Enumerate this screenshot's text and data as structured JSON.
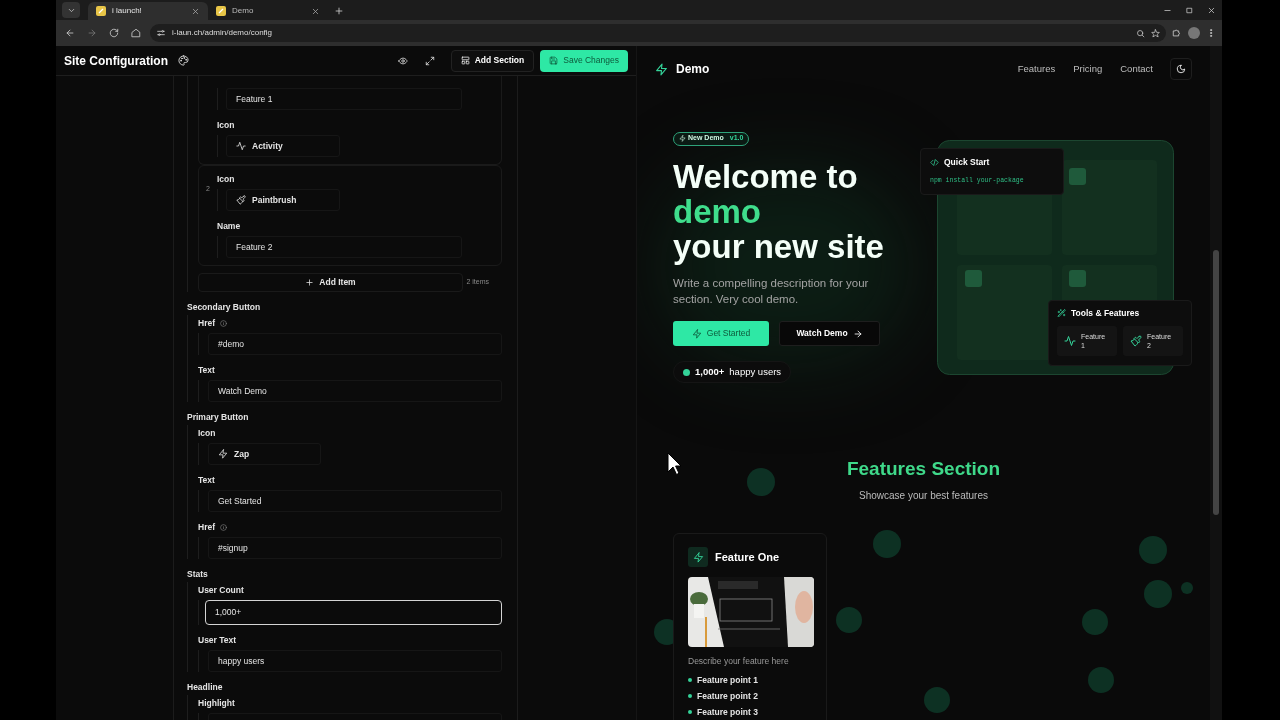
{
  "browser": {
    "tabs": [
      {
        "title": "i launch!",
        "selected": true
      },
      {
        "title": "Demo",
        "selected": false
      }
    ],
    "url": "i-laun.ch/admin/demo/config"
  },
  "header": {
    "title": "Site Configuration",
    "add_section": "Add Section",
    "save": "Save Changes"
  },
  "editor": {
    "items": [
      {
        "fields": [
          {
            "kind": "text",
            "value": "Feature 1"
          },
          {
            "label": "Icon",
            "kind": "icon",
            "value": "Activity"
          }
        ]
      },
      {
        "index": "2",
        "fields": [
          {
            "label": "Icon",
            "kind": "icon",
            "value": "Paintbrush"
          },
          {
            "label": "Name",
            "kind": "text",
            "value": "Feature 2"
          }
        ]
      }
    ],
    "add_item": "Add Item",
    "count": "2 items",
    "groups": [
      {
        "title": "Secondary Button",
        "fields": [
          {
            "label": "Href",
            "info": true,
            "focused": false,
            "kind": "text",
            "value": "#demo"
          },
          {
            "label": "Text",
            "info": false,
            "focused": false,
            "kind": "text",
            "value": "Watch Demo"
          }
        ]
      },
      {
        "title": "Primary Button",
        "fields": [
          {
            "label": "Icon",
            "info": false,
            "focused": false,
            "kind": "icon",
            "value": "Zap"
          },
          {
            "label": "Text",
            "info": false,
            "focused": false,
            "kind": "text",
            "value": "Get Started"
          },
          {
            "label": "Href",
            "info": true,
            "focused": false,
            "kind": "text",
            "value": "#signup"
          }
        ]
      },
      {
        "title": "Stats",
        "fields": [
          {
            "label": "User Count",
            "info": false,
            "focused": true,
            "kind": "text",
            "value": "1,000+"
          },
          {
            "label": "User Text",
            "info": false,
            "focused": false,
            "kind": "text",
            "value": "happy users"
          }
        ]
      },
      {
        "title": "Headline",
        "fields": [
          {
            "label": "Highlight",
            "info": false,
            "focused": false,
            "kind": "text"
          }
        ]
      }
    ]
  },
  "preview": {
    "brand": "Demo",
    "nav": [
      "Features",
      "Pricing",
      "Contact"
    ],
    "hero": {
      "badge": {
        "label": "New Demo",
        "version": "v1.0"
      },
      "headline": [
        {
          "text": "Welcome to",
          "highlight": false
        },
        {
          "text": "demo",
          "highlight": true
        },
        {
          "text": "your new site",
          "highlight": false
        }
      ],
      "description": "Write a compelling description for your section. Very cool demo.",
      "primary_button": "Get Started",
      "secondary_button": "Watch Demo",
      "stat": {
        "count": "1,000+",
        "text": "happy users"
      }
    },
    "mockup": {
      "quick_start": {
        "title": "Quick Start",
        "code": "npm install your-package"
      },
      "tools": {
        "title": "Tools & Features",
        "items": [
          "Feature 1",
          "Feature 2"
        ]
      }
    },
    "features": {
      "title": "Features Section",
      "subtitle": "Showcase your best features",
      "cards": [
        {
          "title": "Feature One",
          "image": {
            "kind": "picture"
          },
          "description": "Describe your feature here",
          "points": [
            "Feature point 1",
            "Feature point 2",
            "Feature point 3"
          ]
        }
      ]
    }
  }
}
